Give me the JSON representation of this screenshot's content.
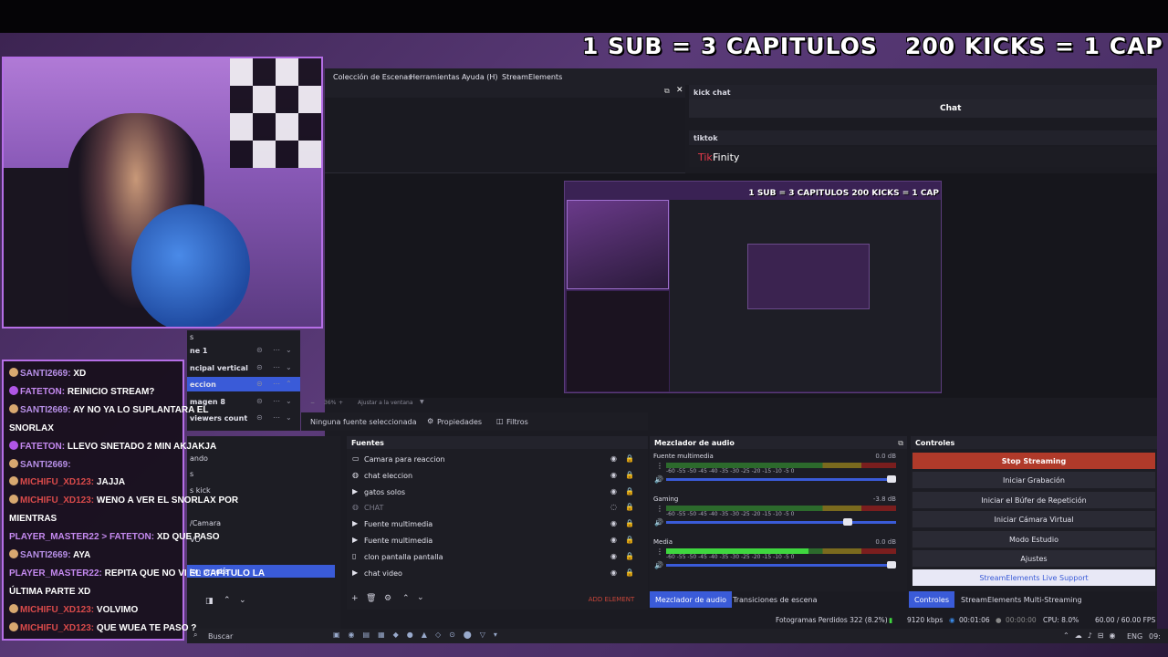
{
  "banner": {
    "left": "1 SUB = 3 CAPITULOS",
    "right": "200 KICKS = 1 CAP"
  },
  "menubar": {
    "items": [
      "Colección de Escenas",
      "Herramientas",
      "Ayuda (H)",
      "StreamElements"
    ]
  },
  "docks": {
    "kick_title": "kick chat",
    "chat_label": "Chat",
    "tiktok_title": "tiktok",
    "tikfinity_prefix": "Tik",
    "tikfinity_suffix": "Finity"
  },
  "preview": {
    "title": "1 SUB = 3 CAPITULOS    200 KICKS = 1 CAP",
    "zoom": "36%",
    "fit_label": "Ajustar a la ventana"
  },
  "source_toolbar": {
    "none_selected": "Ninguna fuente seleccionada",
    "properties": "Propiedades",
    "filters": "Filtros"
  },
  "scenes": [
    {
      "label": "ne 1",
      "selected": false
    },
    {
      "label": "ncipal vertical",
      "selected": false
    },
    {
      "label": "eccion",
      "selected": true
    },
    {
      "label": "magen 8",
      "selected": false
    },
    {
      "label": "viewers count",
      "selected": false
    }
  ],
  "scenes_header": "s",
  "left_list": [
    "ando",
    "s",
    "s kick",
    "/Camara",
    "VO",
    "ion prueba"
  ],
  "sources": {
    "title": "Fuentes",
    "items": [
      {
        "icon": "camera-icon",
        "label": "Camara para reaccion",
        "dim": false
      },
      {
        "icon": "globe-icon",
        "label": "chat eleccion",
        "dim": false
      },
      {
        "icon": "play-icon",
        "label": "gatos solos",
        "dim": false
      },
      {
        "icon": "globe-icon",
        "label": "CHAT",
        "dim": true
      },
      {
        "icon": "play-icon",
        "label": "Fuente multimedia",
        "dim": false
      },
      {
        "icon": "play-icon",
        "label": "Fuente multimedia",
        "dim": false
      },
      {
        "icon": "window-icon",
        "label": "clon pantalla pantalla",
        "dim": false
      },
      {
        "icon": "play-icon",
        "label": "chat video",
        "dim": false
      }
    ],
    "add_element": "ADD ELEMENT"
  },
  "mixer": {
    "title": "Mezclador de audio",
    "channels": [
      {
        "name": "Fuente multimedia",
        "db": "0.0 dB",
        "level": 0.0,
        "volume": 1.0
      },
      {
        "name": "Gaming",
        "db": "-3.8 dB",
        "level": 0.0,
        "volume": 0.8
      },
      {
        "name": "Media",
        "db": "0.0 dB",
        "level": 0.62,
        "volume": 1.0
      }
    ],
    "ticks": "-60  -55  -50  -45  -40  -35  -30  -25  -20  -15  -10  -5  0"
  },
  "mixer_tabs": [
    "Mezclador de audio",
    "Transiciones de escena"
  ],
  "controls": {
    "title": "Controles",
    "buttons": [
      "Stop Streaming",
      "Iniciar Grabación",
      "Iniciar el Búfer de Repetición",
      "Iniciar Cámara Virtual",
      "Modo Estudio",
      "Ajustes",
      "StreamElements Live Support"
    ]
  },
  "control_tabs": [
    "Controles",
    "StreamElements Multi-Streaming"
  ],
  "status": {
    "dropped": "Fotogramas Perdidos 322 (8.2%)",
    "bitrate": "9120 kbps",
    "stream_time": "00:01:06",
    "rec_time": "00:00:00",
    "cpu": "CPU: 8.0%",
    "fps": "60.00 / 60.00 FPS"
  },
  "taskbar": {
    "search": "Buscar",
    "lang": "ENG",
    "clock": "09:"
  },
  "chat": [
    {
      "user": "SANTI2669:",
      "msg": "XD",
      "style": "u1",
      "badge": "b"
    },
    {
      "user": "FATETON:",
      "msg": "REINICIO STREAM?",
      "style": "u3",
      "badge": "p"
    },
    {
      "user": "SANTI2669:",
      "msg": "AY NO YA LO SUPLANTARA EL",
      "style": "u1",
      "badge": "b"
    },
    {
      "user": "",
      "msg": "SNORLAX",
      "style": "",
      "badge": ""
    },
    {
      "user": "FATETON:",
      "msg": "LLEVO SNETADO 2 MIN AKJAKJA",
      "style": "u3",
      "badge": "p"
    },
    {
      "user": "SANTI2669:",
      "msg": "",
      "style": "u1",
      "badge": "b"
    },
    {
      "user": "MICHIFU_XD123:",
      "msg": "JAJJA",
      "style": "u2",
      "badge": "b"
    },
    {
      "user": "MICHIFU_XD123:",
      "msg": "WENO A VER EL SNORLAX POR",
      "style": "u2",
      "badge": "b"
    },
    {
      "user": "",
      "msg": "MIENTRAS",
      "style": "",
      "badge": ""
    },
    {
      "user": "PLAYER_MASTER22 > FATETON:",
      "msg": "XD QUE PASO",
      "style": "u3",
      "badge": ""
    },
    {
      "user": "SANTI2669:",
      "msg": "AYA",
      "style": "u1",
      "badge": "b"
    },
    {
      "user": "PLAYER_MASTER22:",
      "msg": "REPITA QUE NO VI EL CAPÍTULO LA",
      "style": "u3",
      "badge": ""
    },
    {
      "user": "",
      "msg": "ÚLTIMA PARTE XD",
      "style": "",
      "badge": ""
    },
    {
      "user": "MICHIFU_XD123:",
      "msg": "VOLVIMO",
      "style": "u2",
      "badge": "b"
    },
    {
      "user": "MICHIFU_XD123:",
      "msg": "QUE WUEA TE PASO ?",
      "style": "u2",
      "badge": "b"
    }
  ]
}
